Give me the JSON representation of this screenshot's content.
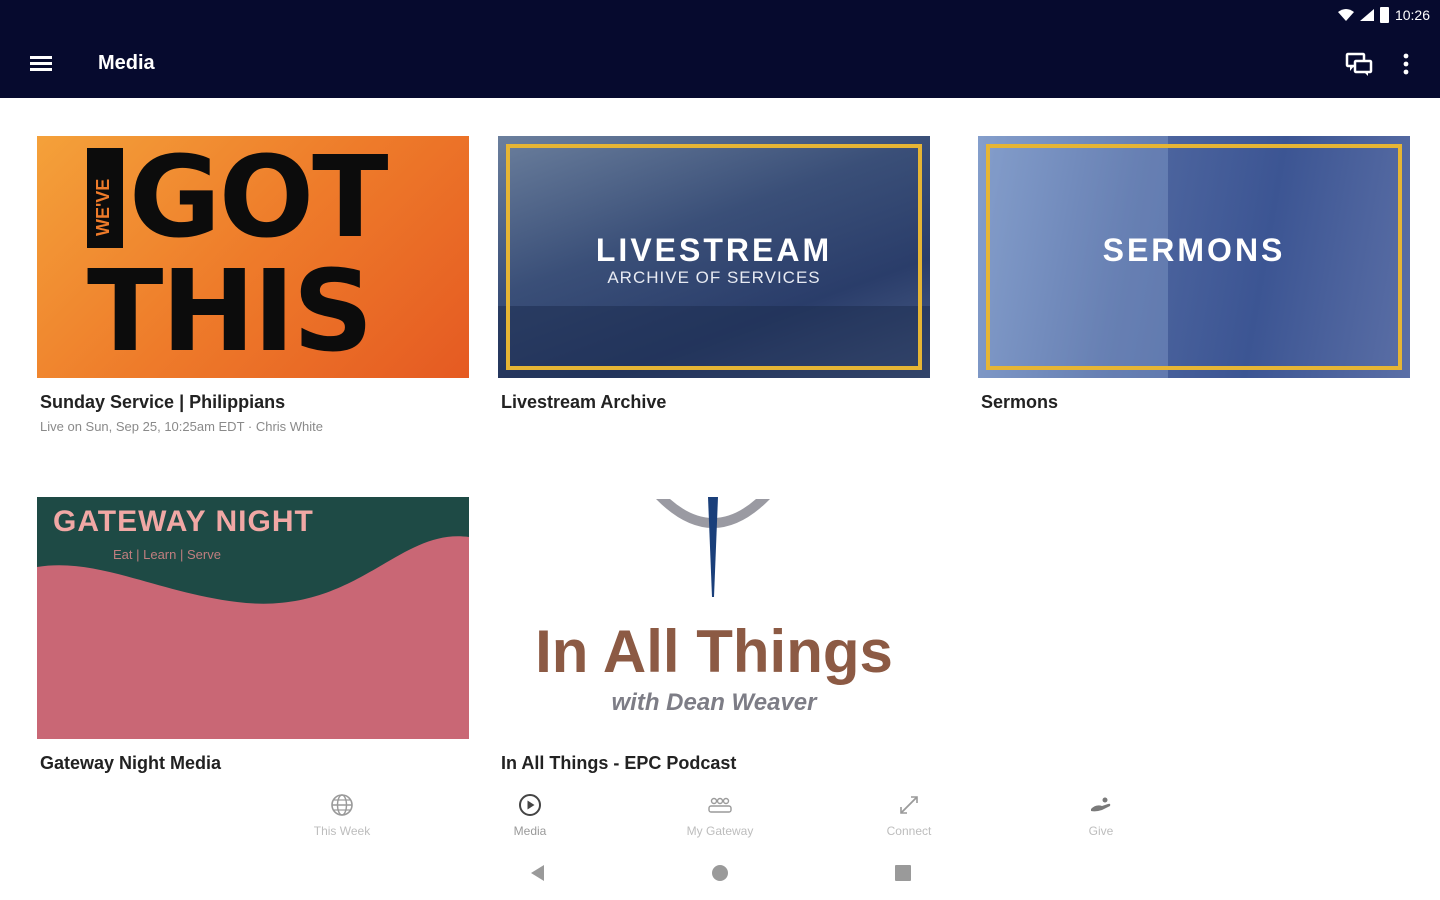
{
  "status_bar": {
    "time": "10:26"
  },
  "app_bar": {
    "title": "Media"
  },
  "cards": [
    {
      "title": "Sunday Service | Philippians",
      "subtitle": "Live on Sun, Sep 25, 10:25am EDT · Chris White",
      "art": {
        "line1": "GOT",
        "line2": "THIS",
        "side": "WE'VE"
      }
    },
    {
      "title": "Livestream Archive",
      "subtitle": "",
      "art": {
        "heading": "LIVESTREAM",
        "sub": "ARCHIVE OF SERVICES"
      }
    },
    {
      "title": "Sermons",
      "subtitle": "",
      "art": {
        "heading": "SERMONS"
      }
    },
    {
      "title": "Gateway Night Media",
      "subtitle": "",
      "art": {
        "heading": "GATEWAY NIGHT",
        "sub": "Eat | Learn | Serve"
      }
    },
    {
      "title": "In All Things - EPC Podcast",
      "subtitle": "",
      "art": {
        "heading": "In All Things",
        "sub": "with Dean Weaver"
      }
    }
  ],
  "bottom_nav": [
    {
      "label": "This Week",
      "icon": "globe-icon"
    },
    {
      "label": "Media",
      "icon": "play-circle-icon",
      "active": true
    },
    {
      "label": "My Gateway",
      "icon": "people-icon"
    },
    {
      "label": "Connect",
      "icon": "connect-icon"
    },
    {
      "label": "Give",
      "icon": "give-icon"
    }
  ],
  "colors": {
    "app_bar": "#060a2e",
    "accent_frame": "#e6b534",
    "podcast_title": "#8c5a44"
  }
}
